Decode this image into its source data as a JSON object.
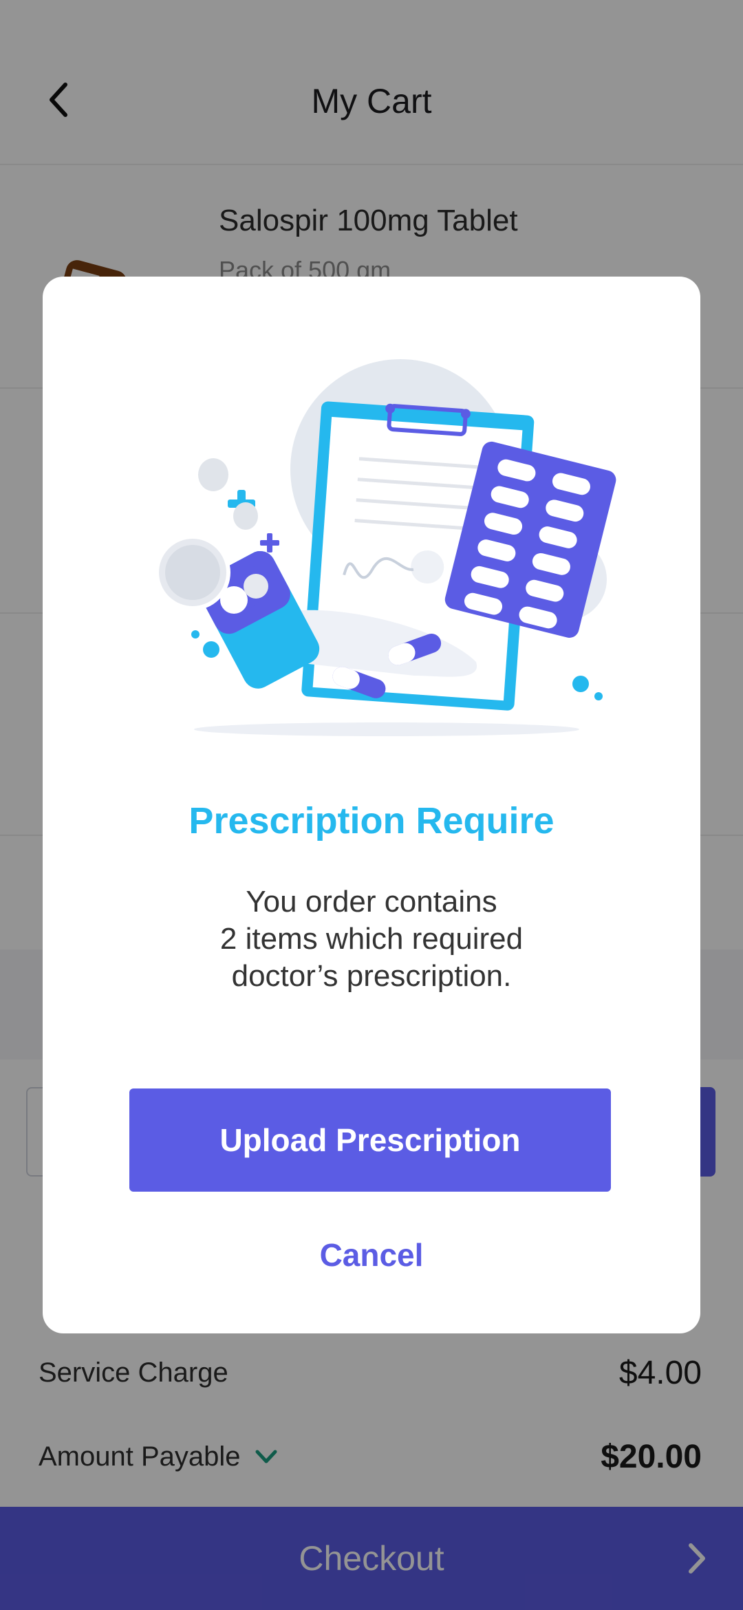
{
  "header": {
    "title": "My Cart",
    "back_icon": "chevron-left-icon"
  },
  "cart": {
    "items": [
      {
        "name": "Salospir 100mg Tablet",
        "pack": "Pack of 500 gm"
      }
    ]
  },
  "summary": {
    "service_charge_label": "Service Charge",
    "service_charge_value": "$4.00",
    "amount_payable_label": "Amount Payable",
    "amount_payable_value": "$20.00",
    "amount_payable_icon": "chevron-down-icon"
  },
  "checkout": {
    "label": "Checkout",
    "icon": "chevron-right-icon"
  },
  "dialog": {
    "title": "Prescription Require",
    "message_line1": "You order contains",
    "message_line2": "2 items which required",
    "message_line3": "doctor’s prescription.",
    "upload_button": "Upload Prescription",
    "cancel_button": "Cancel",
    "illustration": "prescription-illustration"
  },
  "colors": {
    "accent": "#5b5ce4",
    "title_blue": "#25b8ee",
    "overlay": "rgba(0,0,0,0.42)"
  }
}
